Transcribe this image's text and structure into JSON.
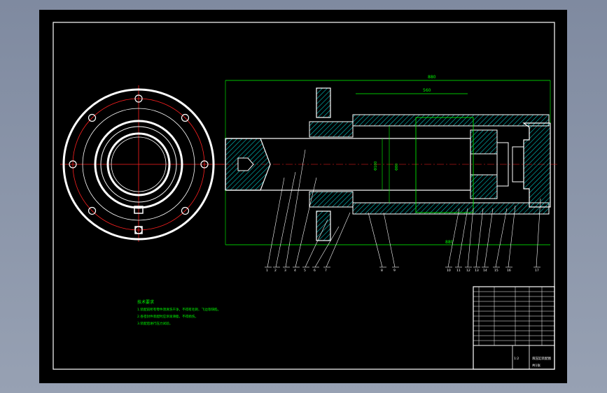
{
  "colors": {
    "background": "#000000",
    "outline": "#ffffff",
    "centerline": "#ff2020",
    "dimension": "#00ff00",
    "hatch": "#00c8c8",
    "chrome": "#8d97a8"
  },
  "notes": {
    "title": "技术要求",
    "line1": "1.装配前所有零件须清洗干净，不得有毛刺、飞边等缺陷。",
    "line2": "2.各密封件装配时应涂润滑脂，不得损伤。",
    "line3": "3.装配后进行压力试验。"
  },
  "dimensions": {
    "overall": "880",
    "stroke": "560",
    "bore": "Φ100",
    "rod": "Φ80"
  },
  "callouts": [
    "1",
    "2",
    "3",
    "4",
    "5",
    "6",
    "7",
    "8",
    "9",
    "10",
    "11",
    "12",
    "13",
    "14",
    "15",
    "16",
    "17"
  ],
  "title_block": {
    "drawing_name": "液压缸装配图",
    "scale": "1:2",
    "sheet": "共1张"
  }
}
